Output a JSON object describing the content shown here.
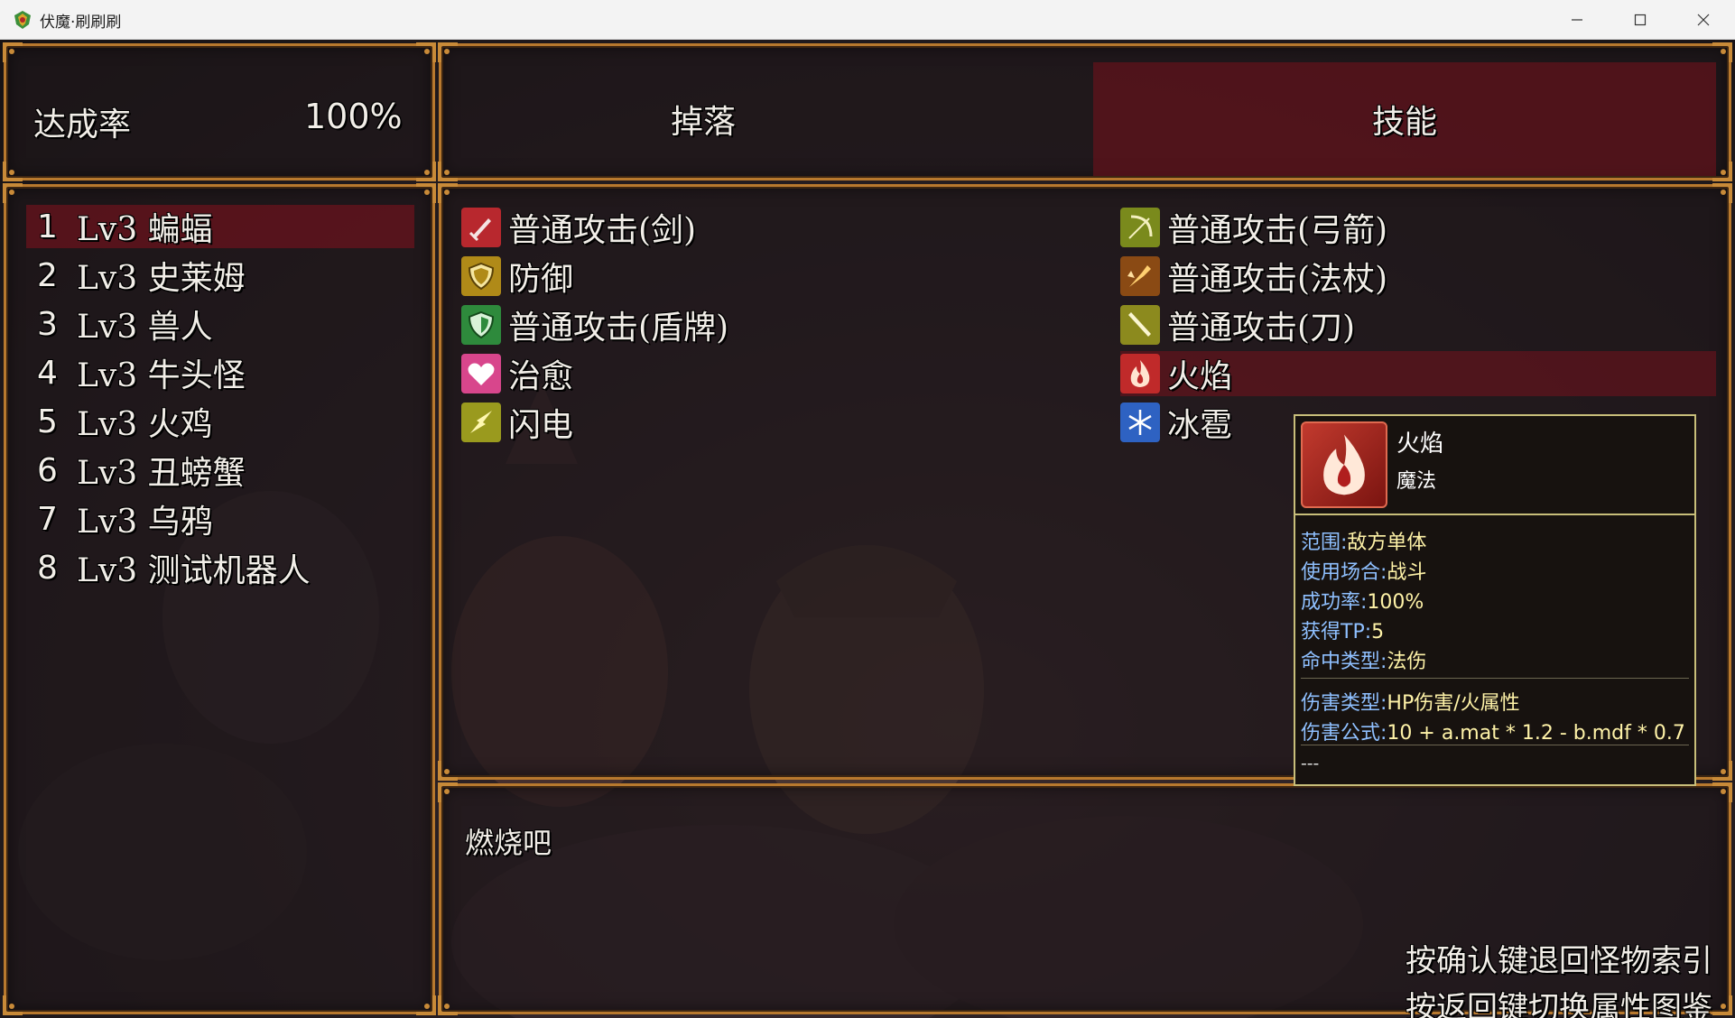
{
  "window": {
    "title": "伏魔·刷刷刷"
  },
  "completion": {
    "label": "达成率",
    "value": "100%"
  },
  "tabs": [
    {
      "label": "掉落",
      "selected": false
    },
    {
      "label": "技能",
      "selected": true
    }
  ],
  "monsters": [
    {
      "num": "1",
      "name": "Lv3 蝙蝠"
    },
    {
      "num": "2",
      "name": "Lv3 史莱姆"
    },
    {
      "num": "3",
      "name": "Lv3 兽人"
    },
    {
      "num": "4",
      "name": "Lv3 牛头怪"
    },
    {
      "num": "5",
      "name": "Lv3 火鸡"
    },
    {
      "num": "6",
      "name": "Lv3 丑螃蟹"
    },
    {
      "num": "7",
      "name": "Lv3 乌鸦"
    },
    {
      "num": "8",
      "name": "Lv3 测试机器人"
    }
  ],
  "skills": [
    {
      "name": "普通攻击(剑)",
      "icon": "sword-icon"
    },
    {
      "name": "普通攻击(弓箭)",
      "icon": "bow-icon"
    },
    {
      "name": "防御",
      "icon": "shield-icon"
    },
    {
      "name": "普通攻击(法杖)",
      "icon": "staff-icon"
    },
    {
      "name": "普通攻击(盾牌)",
      "icon": "green-shield-icon"
    },
    {
      "name": "普通攻击(刀)",
      "icon": "blade-icon"
    },
    {
      "name": "治愈",
      "icon": "heart-icon"
    },
    {
      "name": "火焰",
      "icon": "fire-icon"
    },
    {
      "name": "闪电",
      "icon": "lightning-icon"
    },
    {
      "name": "冰雹",
      "icon": "snowflake-icon"
    }
  ],
  "description": "燃烧吧",
  "hints": [
    "按确认键退回怪物索引",
    "按返回键切换属性图鉴"
  ],
  "tooltip": {
    "name": "火焰",
    "type": "魔法",
    "lines": [
      {
        "k": "范围:",
        "v": "敌方单体"
      },
      {
        "k": "使用场合:",
        "v": "战斗"
      },
      {
        "k": "成功率:",
        "v": "100%"
      },
      {
        "k": "获得TP:",
        "v": "5"
      },
      {
        "k": "命中类型:",
        "v": "法伤"
      },
      {
        "k": "伤害类型:",
        "v": "HP伤害/火属性"
      },
      {
        "k": "伤害公式:",
        "v": "10 + a.mat * 1.2 - b.mdf * 0.7"
      }
    ],
    "footer": "---"
  },
  "colors": {
    "frame_gold": "#b8792e",
    "selection_red": "#6e121c",
    "tooltip_border": "#c8be7a",
    "tooltip_key": "#8fc0ff",
    "tooltip_value": "#fff3a8"
  }
}
